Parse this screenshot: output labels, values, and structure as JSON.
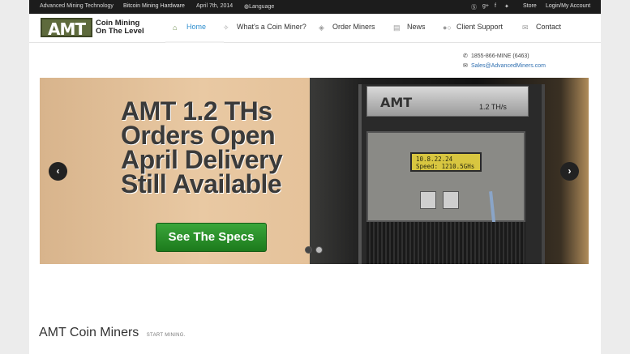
{
  "topbar": {
    "site": "Advanced Mining Technology",
    "hardware": "Bitcoin Mining Hardware",
    "date": "April 7th, 2014",
    "language": "Language",
    "store": "Store",
    "login": "Login/My Account",
    "social_icons": [
      "skype-icon",
      "google-plus-icon",
      "facebook-icon",
      "twitter-icon"
    ]
  },
  "logo": {
    "text": "AMT",
    "tagline": "Coin Mining On The Level"
  },
  "nav": [
    {
      "label": "Home",
      "icon": "home-icon",
      "active": true
    },
    {
      "label": "What's a Coin Miner?",
      "icon": "lightbulb-icon",
      "active": false
    },
    {
      "label": "Order Miners",
      "icon": "box-icon",
      "active": false
    },
    {
      "label": "News",
      "icon": "newspaper-icon",
      "active": false
    },
    {
      "label": "Client Support",
      "icon": "support-icon",
      "active": false
    },
    {
      "label": "Contact",
      "icon": "envelope-icon",
      "active": false
    }
  ],
  "contact": {
    "phone": "1855-866-MINE (6463)",
    "email": "Sales@AdvancedMiners.com"
  },
  "slider": {
    "title_lines": [
      "AMT 1.2 THs",
      "Orders Open",
      "April Delivery",
      "Still Available"
    ],
    "cta": "See The Specs",
    "machine_brand": "AMT",
    "machine_model": "1.2 TH/s",
    "lcd_line1": "10.8.22.24",
    "lcd_line2": "Speed: 1210.5GHs",
    "active_slide": 1,
    "slide_count": 2
  },
  "section": {
    "title": "AMT Coin Miners",
    "subtitle": "START MINING."
  },
  "colors": {
    "accent": "#2f8fcf",
    "logo_bg": "#5e6a3c",
    "cta_green": "#2a922a",
    "topbar_bg": "#1c1c1c"
  }
}
